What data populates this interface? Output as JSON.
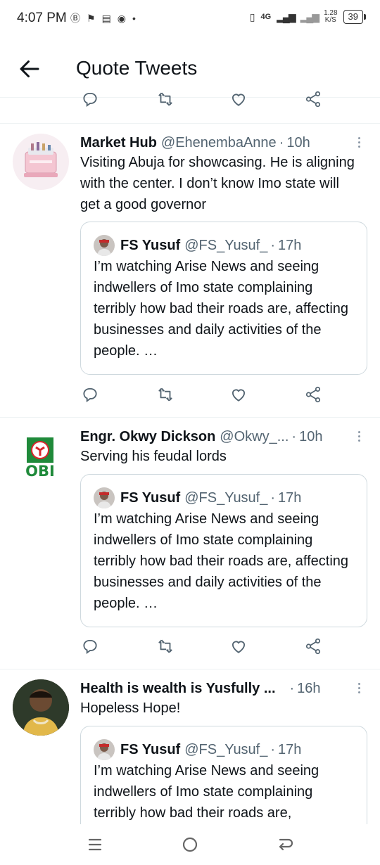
{
  "status_bar": {
    "time": "4:07 PM",
    "network": "4G",
    "speed_value": "1.28",
    "speed_unit": "K/S",
    "battery": "39"
  },
  "header": {
    "title": "Quote Tweets"
  },
  "tweets": [
    {
      "name": "Market Hub",
      "handle": "@EhenembaAnne",
      "time": "10h",
      "text": "Visiting Abuja for showcasing. He is aligning with the center. I don’t know Imo state will get a good governor",
      "quote": {
        "name": "FS Yusuf",
        "handle": "@FS_Yusuf_",
        "time": "17h",
        "text": "I’m watching Arise News and seeing indwellers of Imo state complaining terribly how bad their roads are, affecting businesses and daily activities of the people. …"
      }
    },
    {
      "name": "Engr. Okwy Dickson",
      "handle": "@Okwy_...",
      "time": "10h",
      "text": "Serving his feudal lords",
      "avatar_text": "OBI",
      "quote": {
        "name": "FS Yusuf",
        "handle": "@FS_Yusuf_",
        "time": "17h",
        "text": "I’m watching Arise News and seeing indwellers of Imo state complaining terribly how bad their roads are, affecting businesses and daily activities of the people. …"
      }
    },
    {
      "name": "Health is wealth is Yusfully ...",
      "handle": "",
      "time": "16h",
      "text": "Hopeless Hope!",
      "quote": {
        "name": "FS Yusuf",
        "handle": "@FS_Yusuf_",
        "time": "17h",
        "text": "I’m watching Arise News and seeing indwellers of Imo state complaining terribly how bad their roads are,"
      }
    }
  ],
  "colors": {
    "text_primary": "#0f1419",
    "text_secondary": "#536471",
    "border": "#cfd9de",
    "divider": "#eff3f4",
    "obi_green": "#1f8a3a",
    "obi_red": "#d7262b"
  },
  "icons": [
    "back-arrow-icon",
    "reply-icon",
    "retweet-icon",
    "like-icon",
    "share-icon",
    "more-icon",
    "nav-recents-icon",
    "nav-home-icon",
    "nav-back-icon"
  ]
}
